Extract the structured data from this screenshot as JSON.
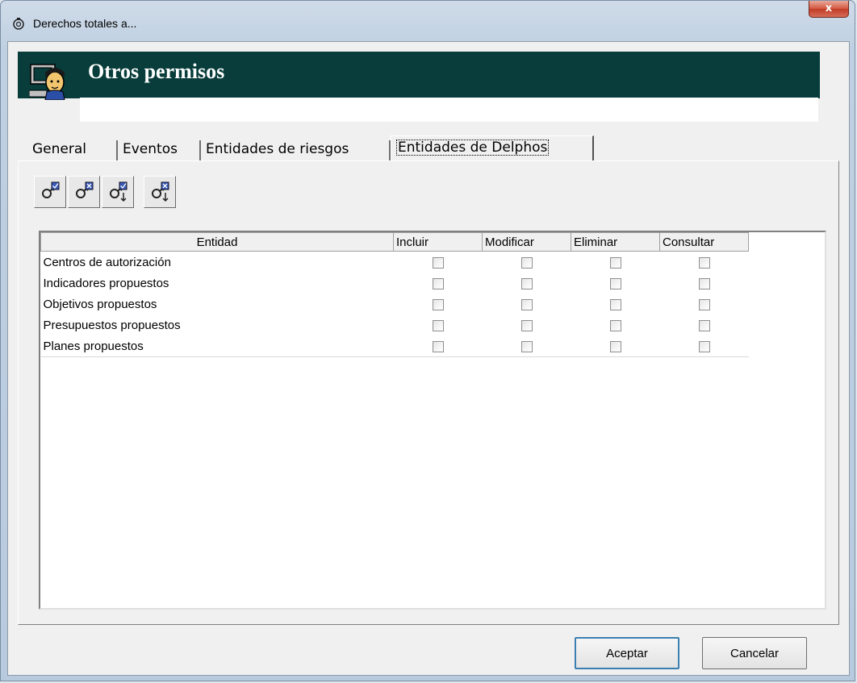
{
  "window": {
    "title": "Derechos totales a...",
    "close_label": "x"
  },
  "banner": {
    "title": "Otros permisos"
  },
  "tabs": [
    {
      "label": "General",
      "active": false
    },
    {
      "label": "Eventos",
      "active": false
    },
    {
      "label": "Entidades de riesgos",
      "active": false
    },
    {
      "label": "Entidades de Delphos",
      "active": true
    }
  ],
  "toolbar": {
    "buttons": [
      {
        "icon": "key-check-all-icon"
      },
      {
        "icon": "key-uncheck-all-icon"
      },
      {
        "icon": "key-check-column-icon"
      },
      {
        "icon": "key-uncheck-column-icon"
      }
    ]
  },
  "grid": {
    "columns": [
      "Entidad",
      "Incluir",
      "Modificar",
      "Eliminar",
      "Consultar"
    ],
    "rows": [
      {
        "entity": "Centros de autorización",
        "incluir": false,
        "modificar": false,
        "eliminar": false,
        "consultar": false
      },
      {
        "entity": "Indicadores propuestos",
        "incluir": false,
        "modificar": false,
        "eliminar": false,
        "consultar": false
      },
      {
        "entity": "Objetivos propuestos",
        "incluir": false,
        "modificar": false,
        "eliminar": false,
        "consultar": false
      },
      {
        "entity": "Presupuestos propuestos",
        "incluir": false,
        "modificar": false,
        "eliminar": false,
        "consultar": false
      },
      {
        "entity": "Planes propuestos",
        "incluir": false,
        "modificar": false,
        "eliminar": false,
        "consultar": false
      }
    ]
  },
  "buttons": {
    "accept_label": "Aceptar",
    "cancel_label": "Cancelar"
  },
  "colors": {
    "banner_bg": "#083d3b",
    "banner_text": "#ffffff",
    "close_button": "#c13c26"
  }
}
